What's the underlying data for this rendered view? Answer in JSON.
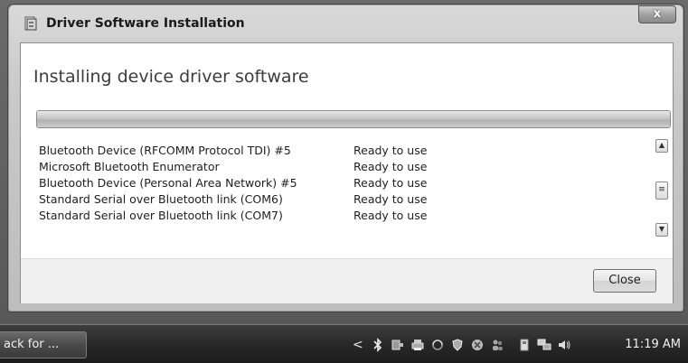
{
  "window": {
    "title": "Driver Software Installation",
    "close_glyph": "x"
  },
  "content": {
    "heading": "Installing device driver software",
    "progress": 1.0,
    "devices": [
      {
        "name": "Bluetooth Device (RFCOMM Protocol TDI) #5",
        "status": "Ready to use"
      },
      {
        "name": "Microsoft Bluetooth Enumerator",
        "status": "Ready to use"
      },
      {
        "name": "Bluetooth Device (Personal Area Network) #5",
        "status": "Ready to use"
      },
      {
        "name": "Standard Serial over Bluetooth link (COM6)",
        "status": "Ready to use"
      },
      {
        "name": "Standard Serial over Bluetooth link (COM7)",
        "status": "Ready to use"
      }
    ],
    "close_label": "Close"
  },
  "taskbar": {
    "task_label": "ack for ...",
    "tray_chevron": "<",
    "tray_icons": [
      "bluetooth-icon",
      "network-adapter-icon",
      "printer-icon",
      "sync-icon",
      "security-shield-icon",
      "disconnected-icon",
      "users-icon",
      "device-icon",
      "network-icon",
      "volume-icon"
    ],
    "clock": "11:19 AM"
  },
  "colors": {
    "taskbar": "#2a2a2a",
    "window_frame": "#c9c9c9",
    "client": "#ffffff"
  }
}
